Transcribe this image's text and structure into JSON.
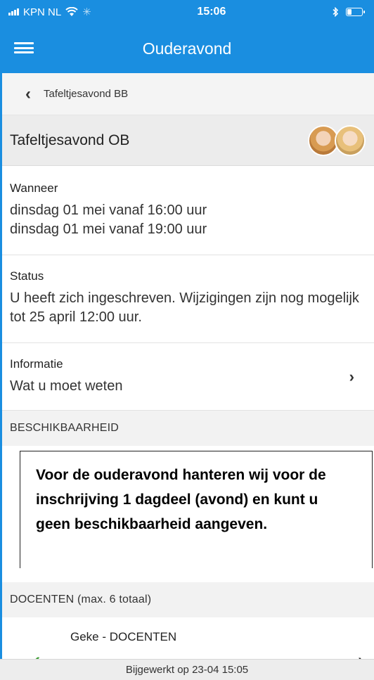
{
  "status_bar": {
    "carrier": "KPN NL",
    "time": "15:06",
    "icons": [
      "signal-icon",
      "wifi-icon",
      "bluetooth-icon",
      "battery-icon"
    ]
  },
  "navbar": {
    "title": "Ouderavond",
    "menu_icon": "hamburger-menu-icon"
  },
  "breadcrumb": {
    "label": "Tafeltjesavond BB"
  },
  "header": {
    "title": "Tafeltjesavond OB"
  },
  "when": {
    "label": "Wanneer",
    "lines": [
      "dinsdag 01 mei vanaf 16:00 uur",
      "dinsdag 01 mei vanaf 19:00 uur"
    ]
  },
  "status": {
    "label": "Status",
    "text": "U heeft zich ingeschreven. Wijzigingen zijn nog mogelijk tot 25 april 12:00 uur."
  },
  "info": {
    "label": "Informatie",
    "value": "Wat u moet weten"
  },
  "availability": {
    "header": "BESCHIKBAARHEID",
    "notice": "Voor de ouderavond hanteren wij voor de inschrijving 1 dagdeel (avond) en kunt u geen beschikbaarheid aangeven."
  },
  "teachers": {
    "header": "DOCENTEN (max. 6 totaal)",
    "items": [
      {
        "name": "Geke - DOCENTEN"
      }
    ]
  },
  "footer": {
    "updated": "Bijgewerkt op 23-04 15:05"
  },
  "colors": {
    "brand": "#1a8ee0",
    "check": "#3a9b30"
  }
}
